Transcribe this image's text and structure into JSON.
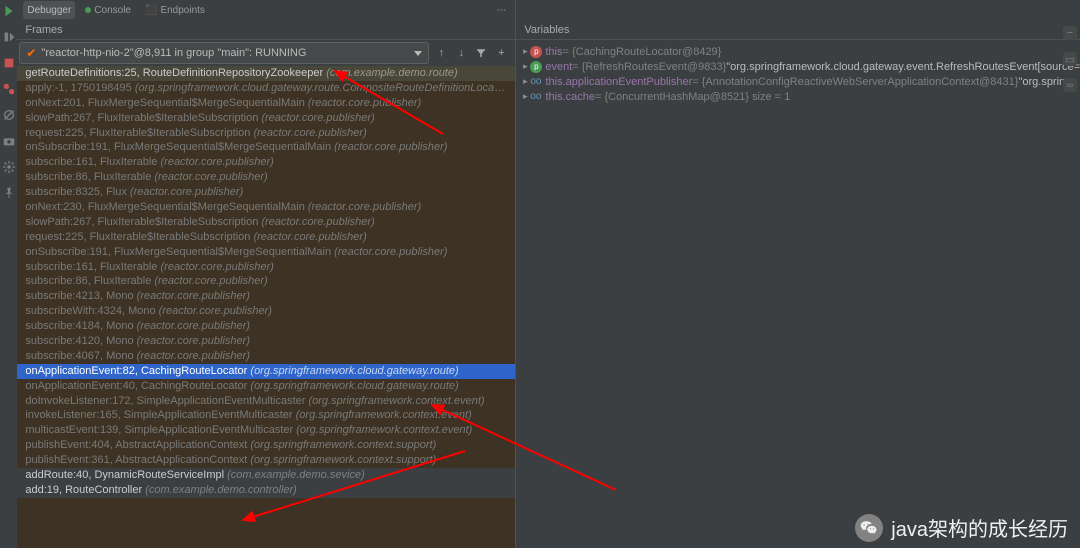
{
  "tabs": {
    "debugger": "Debugger",
    "console": "Console",
    "endpoints": "Endpoints"
  },
  "panel": {
    "frames": "Frames",
    "variables": "Variables"
  },
  "thread": {
    "text": "\"reactor-http-nio-2\"@8,911 in group \"main\": RUNNING"
  },
  "frames": [
    {
      "cls": "own",
      "main": "getRouteDefinitions:25, RouteDefinitionRepositoryZookeeper ",
      "pkg": "(com.example.demo.route)"
    },
    {
      "cls": "lib",
      "main": "apply:-1, 1750198495 ",
      "pkg": "(org.springframework.cloud.gateway.route.CompositeRouteDefinitionLocator$$La..."
    },
    {
      "cls": "lib",
      "main": "onNext:201, FluxMergeSequential$MergeSequentialMain ",
      "pkg": "(reactor.core.publisher)"
    },
    {
      "cls": "lib",
      "main": "slowPath:267, FluxIterable$IterableSubscription ",
      "pkg": "(reactor.core.publisher)"
    },
    {
      "cls": "lib",
      "main": "request:225, FluxIterable$IterableSubscription ",
      "pkg": "(reactor.core.publisher)"
    },
    {
      "cls": "lib",
      "main": "onSubscribe:191, FluxMergeSequential$MergeSequentialMain ",
      "pkg": "(reactor.core.publisher)"
    },
    {
      "cls": "lib",
      "main": "subscribe:161, FluxIterable ",
      "pkg": "(reactor.core.publisher)"
    },
    {
      "cls": "lib",
      "main": "subscribe:86, FluxIterable ",
      "pkg": "(reactor.core.publisher)"
    },
    {
      "cls": "lib",
      "main": "subscribe:8325, Flux ",
      "pkg": "(reactor.core.publisher)"
    },
    {
      "cls": "lib",
      "main": "onNext:230, FluxMergeSequential$MergeSequentialMain ",
      "pkg": "(reactor.core.publisher)"
    },
    {
      "cls": "lib",
      "main": "slowPath:267, FluxIterable$IterableSubscription ",
      "pkg": "(reactor.core.publisher)"
    },
    {
      "cls": "lib",
      "main": "request:225, FluxIterable$IterableSubscription ",
      "pkg": "(reactor.core.publisher)"
    },
    {
      "cls": "lib",
      "main": "onSubscribe:191, FluxMergeSequential$MergeSequentialMain ",
      "pkg": "(reactor.core.publisher)"
    },
    {
      "cls": "lib",
      "main": "subscribe:161, FluxIterable ",
      "pkg": "(reactor.core.publisher)"
    },
    {
      "cls": "lib",
      "main": "subscribe:86, FluxIterable ",
      "pkg": "(reactor.core.publisher)"
    },
    {
      "cls": "lib",
      "main": "subscribe:4213, Mono ",
      "pkg": "(reactor.core.publisher)"
    },
    {
      "cls": "lib",
      "main": "subscribeWith:4324, Mono ",
      "pkg": "(reactor.core.publisher)"
    },
    {
      "cls": "lib",
      "main": "subscribe:4184, Mono ",
      "pkg": "(reactor.core.publisher)"
    },
    {
      "cls": "lib",
      "main": "subscribe:4120, Mono ",
      "pkg": "(reactor.core.publisher)"
    },
    {
      "cls": "lib",
      "main": "subscribe:4067, Mono ",
      "pkg": "(reactor.core.publisher)"
    },
    {
      "cls": "sel",
      "main": "onApplicationEvent:82, CachingRouteLocator ",
      "pkg": "(org.springframework.cloud.gateway.route)"
    },
    {
      "cls": "lib",
      "main": "onApplicationEvent:40, CachingRouteLocator ",
      "pkg": "(org.springframework.cloud.gateway.route)"
    },
    {
      "cls": "lib",
      "main": "doInvokeListener:172, SimpleApplicationEventMulticaster ",
      "pkg": "(org.springframework.context.event)"
    },
    {
      "cls": "lib",
      "main": "invokeListener:165, SimpleApplicationEventMulticaster ",
      "pkg": "(org.springframework.context.event)"
    },
    {
      "cls": "lib",
      "main": "multicastEvent:139, SimpleApplicationEventMulticaster ",
      "pkg": "(org.springframework.context.event)"
    },
    {
      "cls": "lib",
      "main": "publishEvent:404, AbstractApplicationContext ",
      "pkg": "(org.springframework.context.support)"
    },
    {
      "cls": "lib",
      "main": "publishEvent:361, AbstractApplicationContext ",
      "pkg": "(org.springframework.context.support)"
    },
    {
      "cls": "bottom",
      "main": "addRoute:40, DynamicRouteServiceImpl ",
      "pkg": "(com.example.demo.sevice)"
    },
    {
      "cls": "bottom",
      "main": "add:19, RouteController ",
      "pkg": "(com.example.demo.controller)"
    }
  ],
  "vars": [
    {
      "tri": "▸",
      "ico": "red",
      "oo": "",
      "lhs": "this",
      "rhs": " = {CachingRouteLocator@8429}",
      "ext": ""
    },
    {
      "tri": "▸",
      "ico": "green",
      "oo": "",
      "lhs": "event",
      "rhs": " = {RefreshRoutesEvent@9833} ",
      "ext": "\"org.springframework.cloud.gateway.event.RefreshRoutesEvent[source="
    },
    {
      "tri": "▸",
      "ico": "",
      "oo": "oo",
      "lhs": "this.applicationEventPublisher",
      "rhs": " = {AnnotationConfigReactiveWebServerApplicationContext@8431} ",
      "ext": "\"org.spring"
    },
    {
      "tri": "▸",
      "ico": "",
      "oo": "oo",
      "lhs": "this.cache",
      "rhs": " = {ConcurrentHashMap@8521}  size = 1",
      "ext": ""
    }
  ],
  "watermark": "java架构的成长经历"
}
